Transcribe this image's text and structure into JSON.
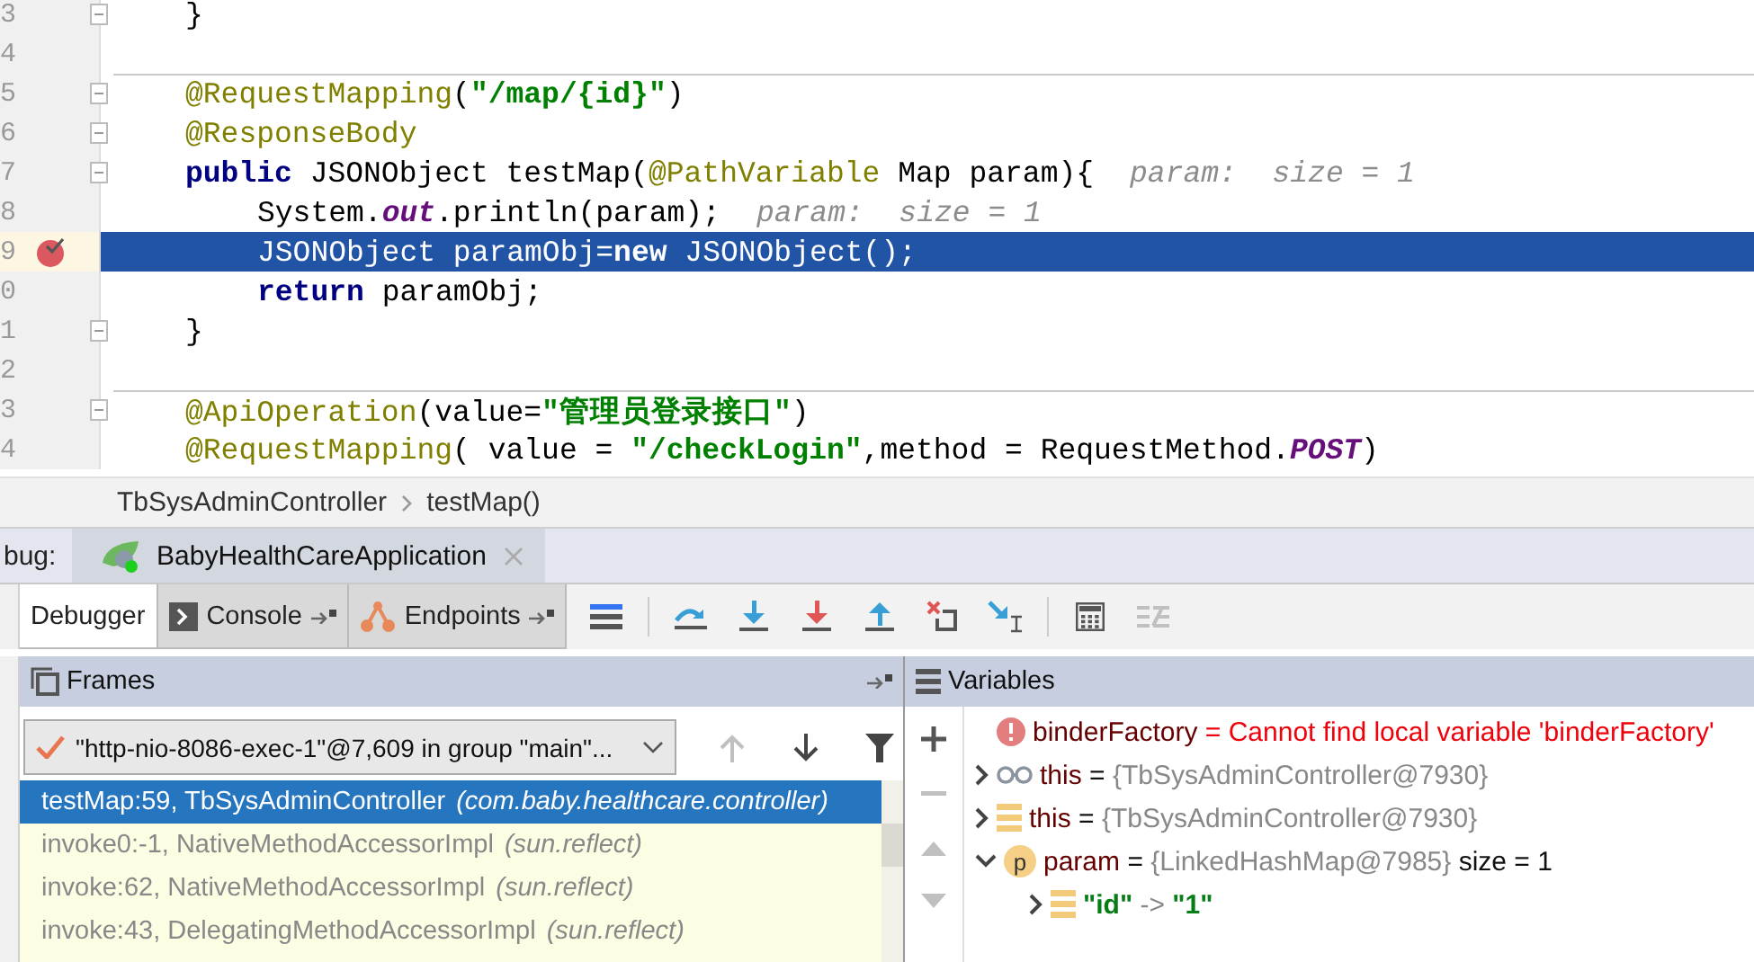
{
  "editor": {
    "lines": [
      {
        "number": "3",
        "fold_marker": true,
        "separator_above": false,
        "highlighted": false,
        "breakpoint": false,
        "tokens": [
          {
            "text": "}",
            "kind": "plain"
          }
        ]
      },
      {
        "number": "4",
        "fold_marker": false,
        "separator_above": false,
        "highlighted": false,
        "breakpoint": false
      },
      {
        "number": "5",
        "fold_marker": true,
        "separator_above": true,
        "highlighted": false,
        "breakpoint": false,
        "tokens": [
          {
            "text": "@RequestMapping",
            "kind": "annotation"
          },
          {
            "text": "(",
            "kind": "plain"
          },
          {
            "text": "\"/map/{id}\"",
            "kind": "string"
          },
          {
            "text": ")",
            "kind": "plain"
          }
        ]
      },
      {
        "number": "6",
        "fold_marker": true,
        "separator_above": false,
        "highlighted": false,
        "breakpoint": false,
        "tokens": [
          {
            "text": "@ResponseBody",
            "kind": "annotation"
          }
        ]
      },
      {
        "number": "7",
        "fold_marker": true,
        "separator_above": false,
        "highlighted": false,
        "breakpoint": false,
        "tokens": [
          {
            "text": "public",
            "kind": "keyword"
          },
          {
            "text": " JSONObject testMap(",
            "kind": "plain"
          },
          {
            "text": "@PathVariable",
            "kind": "annotation"
          },
          {
            "text": " Map param){",
            "kind": "plain"
          },
          {
            "text": "param:  size = 1",
            "kind": "hint"
          }
        ],
        "children": [
          {
            "number": "8",
            "fold_marker": false,
            "separator_above": false,
            "highlighted": false,
            "breakpoint": false,
            "tokens": [
              {
                "text": "System.",
                "kind": "plain"
              },
              {
                "text": "out",
                "kind": "field"
              },
              {
                "text": ".println(param);",
                "kind": "plain"
              },
              {
                "text": "param:  size = 1",
                "kind": "hint"
              }
            ]
          },
          {
            "number": "9",
            "fold_marker": false,
            "separator_above": false,
            "highlighted": true,
            "breakpoint": true,
            "tokens": [
              {
                "text": "JSONObject paramObj=",
                "kind": "plain"
              },
              {
                "text": "new",
                "kind": "keyword"
              },
              {
                "text": " JSONObject();",
                "kind": "plain"
              }
            ]
          },
          {
            "number": "0",
            "fold_marker": false,
            "separator_above": false,
            "highlighted": false,
            "breakpoint": false,
            "tokens": [
              {
                "text": "return",
                "kind": "keyword"
              },
              {
                "text": " paramObj;",
                "kind": "plain"
              }
            ]
          }
        ]
      },
      {
        "number": "1",
        "fold_marker": true,
        "separator_above": false,
        "highlighted": false,
        "breakpoint": false,
        "tokens": [
          {
            "text": "}",
            "kind": "plain"
          }
        ]
      },
      {
        "number": "2",
        "fold_marker": false,
        "separator_above": false,
        "highlighted": false,
        "breakpoint": false
      },
      {
        "number": "3",
        "fold_marker": true,
        "separator_above": true,
        "highlighted": false,
        "breakpoint": false,
        "tokens": [
          {
            "text": "@ApiOperation",
            "kind": "annotation"
          },
          {
            "text": "(value=",
            "kind": "plain"
          },
          {
            "text": "\"管理员登录接口\"",
            "kind": "string"
          },
          {
            "text": ")",
            "kind": "plain"
          }
        ]
      },
      {
        "number": "4",
        "fold_marker": false,
        "separator_above": false,
        "highlighted": false,
        "breakpoint": false,
        "tokens": [
          {
            "text": "@RequestMapping",
            "kind": "annotation"
          },
          {
            "text": "( value = ",
            "kind": "plain"
          },
          {
            "text": "\"/checkLogin\"",
            "kind": "string"
          },
          {
            "text": ",method = RequestMethod.",
            "kind": "plain"
          },
          {
            "text": "POST",
            "kind": "constant"
          },
          {
            "text": ")",
            "kind": "plain"
          }
        ]
      }
    ]
  },
  "breadcrumb": [
    "TbSysAdminController",
    "testMap()"
  ],
  "debug_bar": {
    "label": "bug:",
    "session_tab": "BabyHealthCareApplication"
  },
  "tool_tabs": [
    {
      "label": "Debugger",
      "selected": true,
      "pinnable": false
    },
    {
      "label": "Console",
      "selected": false,
      "pinnable": true
    },
    {
      "label": "Endpoints",
      "selected": false,
      "pinnable": true
    }
  ],
  "toolbar": [
    {
      "disabled": false
    },
    {
      "disabled": false
    },
    {
      "disabled": false
    },
    {
      "disabled": false
    },
    {
      "disabled": false
    },
    {
      "disabled": false
    },
    {
      "disabled": false
    },
    {
      "disabled": false
    },
    {
      "disabled": true
    }
  ],
  "frames": {
    "title": "Frames",
    "thread": "\"http-nio-8086-exec-1\"@7,609 in group \"main\"...",
    "nav": [
      {
        "disabled": true
      },
      {
        "disabled": false
      },
      {
        "disabled": false
      }
    ],
    "items": [
      {
        "method": "testMap:59, TbSysAdminController",
        "package": "(com.baby.healthcare.controller)",
        "selected": true
      },
      {
        "method": "invoke0:-1, NativeMethodAccessorImpl",
        "package": "(sun.reflect)",
        "selected": false
      },
      {
        "method": "invoke:62, NativeMethodAccessorImpl",
        "package": "(sun.reflect)",
        "selected": false
      },
      {
        "method": "invoke:43, DelegatingMethodAccessorImpl",
        "package": "(sun.reflect)",
        "selected": false
      }
    ]
  },
  "variables": {
    "title": "Variables",
    "tools": [
      {
        "disabled": false
      },
      {
        "disabled": true
      },
      {
        "disabled": true
      },
      {
        "disabled": true
      }
    ],
    "items": [
      {
        "kind": "error",
        "expandable": false,
        "name": "binderFactory",
        "separator": "=",
        "value": "Cannot find local variable 'binderFactory'"
      },
      {
        "kind": "watch",
        "expandable": true,
        "expanded": false,
        "name": "this",
        "separator": "=",
        "value": "{TbSysAdminController@7930}"
      },
      {
        "kind": "field",
        "expandable": true,
        "expanded": false,
        "name": "this",
        "separator": "=",
        "value": "{TbSysAdminController@7930}"
      },
      {
        "kind": "param",
        "expandable": true,
        "expanded": true,
        "badge": "p",
        "name": "param",
        "separator": "=",
        "value": "{LinkedHashMap@7985}",
        "extra": "size = 1",
        "children": [
          {
            "kind": "entry",
            "expandable": true,
            "expanded": false,
            "name": "\"id\"",
            "separator": "->",
            "value": "\"1\""
          }
        ]
      }
    ]
  }
}
